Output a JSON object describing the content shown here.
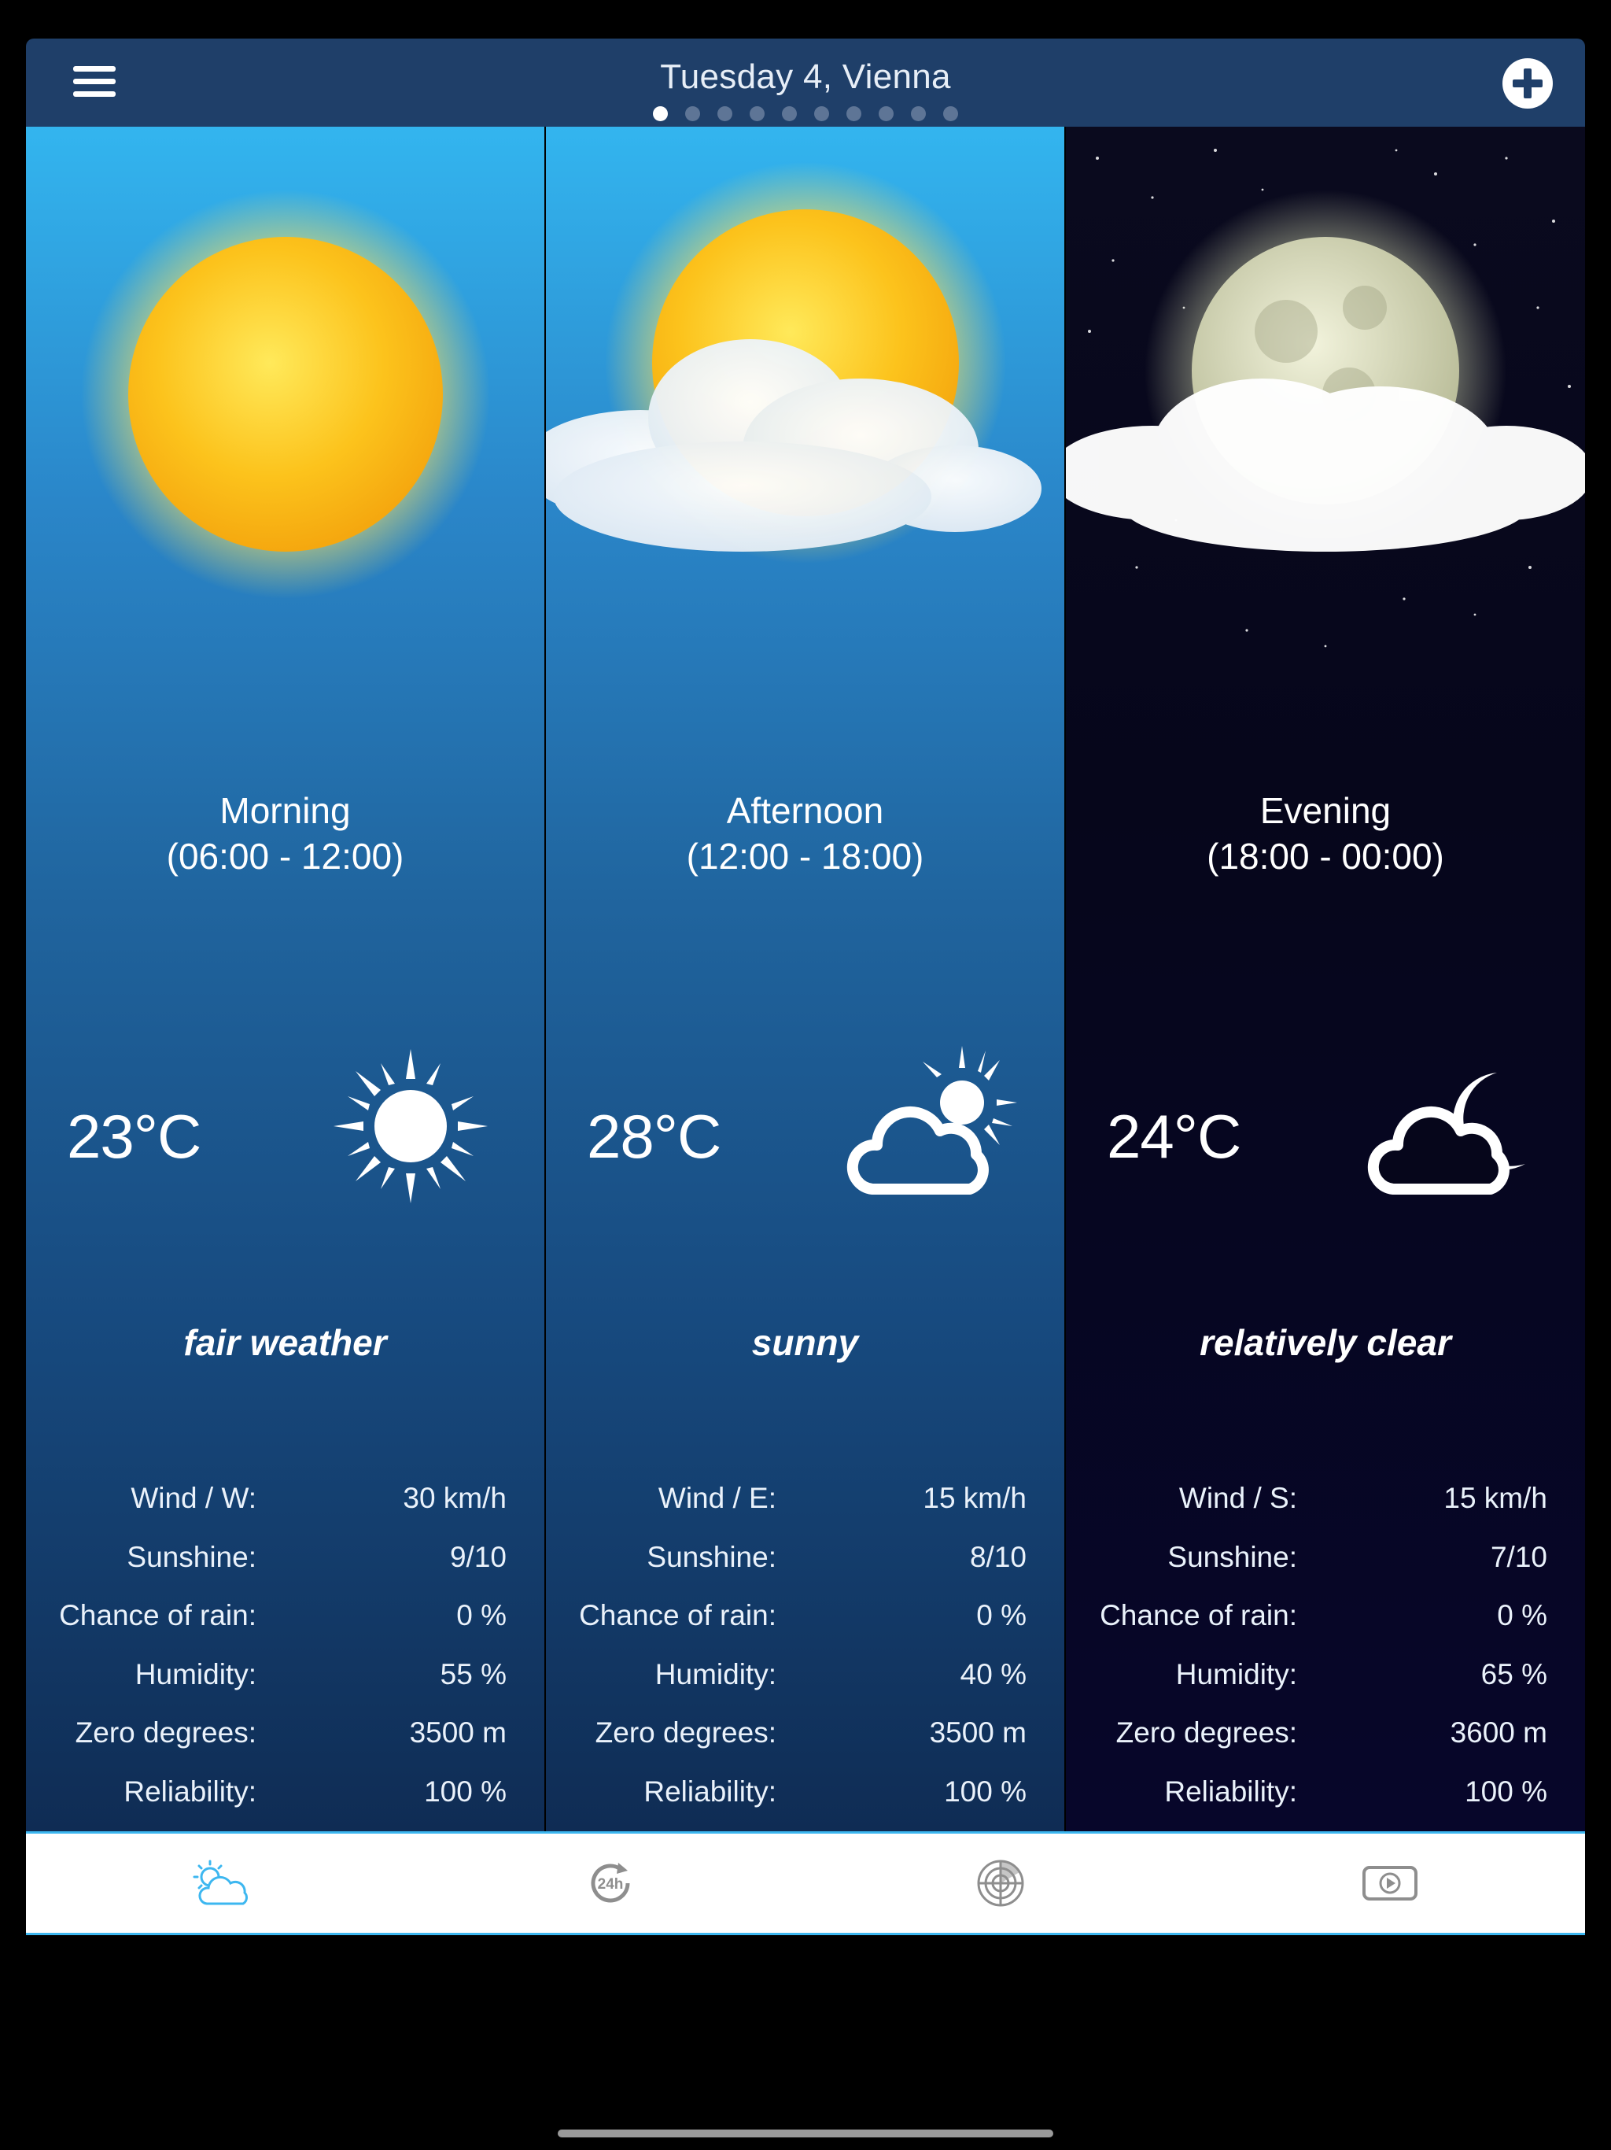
{
  "header": {
    "title": "Tuesday 4, Vienna",
    "page_dots": 10,
    "active_dot": 0
  },
  "panels": [
    {
      "period": "Morning",
      "hours": "(06:00 - 12:00)",
      "temperature": "23°C",
      "condition": "fair weather",
      "icon": "sun-icon",
      "stats": [
        {
          "label": "Wind / W:",
          "value": "30 km/h"
        },
        {
          "label": "Sunshine:",
          "value": "9/10"
        },
        {
          "label": "Chance of rain:",
          "value": "0 %"
        },
        {
          "label": "Humidity:",
          "value": "55 %"
        },
        {
          "label": "Zero degrees:",
          "value": "3500 m"
        },
        {
          "label": "Reliability:",
          "value": "100 %"
        }
      ]
    },
    {
      "period": "Afternoon",
      "hours": "(12:00 - 18:00)",
      "temperature": "28°C",
      "condition": "sunny",
      "icon": "partly-cloudy-icon",
      "stats": [
        {
          "label": "Wind / E:",
          "value": "15 km/h"
        },
        {
          "label": "Sunshine:",
          "value": "8/10"
        },
        {
          "label": "Chance of rain:",
          "value": "0 %"
        },
        {
          "label": "Humidity:",
          "value": "40 %"
        },
        {
          "label": "Zero degrees:",
          "value": "3500 m"
        },
        {
          "label": "Reliability:",
          "value": "100 %"
        }
      ]
    },
    {
      "period": "Evening",
      "hours": "(18:00 - 00:00)",
      "temperature": "24°C",
      "condition": "relatively clear",
      "icon": "cloudy-night-icon",
      "stats": [
        {
          "label": "Wind / S:",
          "value": "15 km/h"
        },
        {
          "label": "Sunshine:",
          "value": "7/10"
        },
        {
          "label": "Chance of rain:",
          "value": "0 %"
        },
        {
          "label": "Humidity:",
          "value": "65 %"
        },
        {
          "label": "Zero degrees:",
          "value": "3600 m"
        },
        {
          "label": "Reliability:",
          "value": "100 %"
        }
      ]
    }
  ],
  "tabs": [
    {
      "icon": "weather-tab-icon",
      "active": true
    },
    {
      "icon": "24h-tab-icon",
      "active": false
    },
    {
      "icon": "radar-tab-icon",
      "active": false
    },
    {
      "icon": "video-tab-icon",
      "active": false
    }
  ],
  "colors": {
    "topbar": "#1f3f69",
    "day_top": "#33b5ef",
    "day_bottom": "#0f2c54",
    "night": "#06061b",
    "tab_accent": "#3db7f0"
  }
}
